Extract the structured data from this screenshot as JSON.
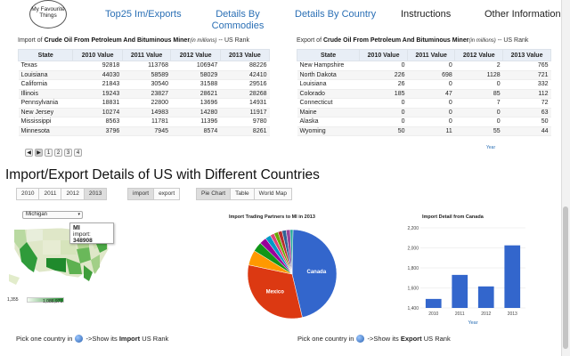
{
  "nav": {
    "logo_text": "My Favourite Things",
    "items": [
      "Top25 Im/Exports",
      "Details By Commodies",
      "Details By Country",
      "Instructions",
      "Other Information"
    ]
  },
  "import_table": {
    "title_prefix": "Import of ",
    "title_bold": "Crude Oil From Petroleum And Bituminous Miner",
    "title_italic": "(in millions)",
    "title_suffix": " -- US Rank",
    "headers": [
      "State",
      "2010 Value",
      "2011 Value",
      "2012 Value",
      "2013 Value"
    ],
    "rows": [
      [
        "Texas",
        "92818",
        "113768",
        "106947",
        "88226"
      ],
      [
        "Louisiana",
        "44030",
        "58589",
        "58029",
        "42410"
      ],
      [
        "California",
        "21843",
        "30540",
        "31588",
        "29516"
      ],
      [
        "Illinois",
        "19243",
        "23827",
        "28621",
        "28268"
      ],
      [
        "Pennsylvania",
        "18831",
        "22800",
        "13696",
        "14931"
      ],
      [
        "New Jersey",
        "10274",
        "14983",
        "14280",
        "11917"
      ],
      [
        "Mississippi",
        "8563",
        "11781",
        "11396",
        "9780"
      ],
      [
        "Minnesota",
        "3796",
        "7945",
        "8574",
        "8261"
      ]
    ]
  },
  "export_table": {
    "title_prefix": "Export of ",
    "title_bold": "Crude Oil From Petroleum And Bituminous Miner",
    "title_italic": "(in millions)",
    "title_suffix": " -- US Rank",
    "headers": [
      "State",
      "2010 Value",
      "2011 Value",
      "2012 Value",
      "2013 Value"
    ],
    "rows": [
      [
        "New Hampshire",
        "0",
        "0",
        "2",
        "765"
      ],
      [
        "North Dakota",
        "226",
        "698",
        "1128",
        "721"
      ],
      [
        "Louisiana",
        "26",
        "0",
        "0",
        "332"
      ],
      [
        "Colorado",
        "185",
        "47",
        "85",
        "112"
      ],
      [
        "Connecticut",
        "0",
        "0",
        "7",
        "72"
      ],
      [
        "Maine",
        "0",
        "0",
        "0",
        "63"
      ],
      [
        "Alaska",
        "0",
        "0",
        "0",
        "50"
      ],
      [
        "Wyoming",
        "50",
        "11",
        "55",
        "44"
      ]
    ]
  },
  "pager": [
    "◀",
    "▶",
    "1",
    "2",
    "3",
    "4"
  ],
  "year_link": "Year",
  "section_title": "Import/Export Details of US with Different Countries",
  "year_buttons": [
    "2010",
    "2011",
    "2012",
    "2013"
  ],
  "active_year": "2013",
  "direction_buttons": [
    "import",
    "export"
  ],
  "view_buttons": [
    "Pie Chart",
    "Table",
    "World Map"
  ],
  "state_select": "Michigan",
  "tooltip": {
    "state": "MI",
    "label": "import:",
    "value": "348908"
  },
  "map_legend": {
    "min": "1,355",
    "max": "1,086,971"
  },
  "pie_title": "Import Trading Partners to MI in 2013",
  "bar_title": "Import Detail from Canada",
  "bottom_left": {
    "prefix": "Pick one country in ",
    "middle": " ->Show its ",
    "bold": "Import",
    "suffix": " US Rank"
  },
  "bottom_right": {
    "prefix": "Pick one country in ",
    "middle": " ->Show its ",
    "bold": "Export",
    "suffix": " US Rank"
  },
  "colors": {
    "accent": "#2a6fb5",
    "bar": "#3366cc",
    "map_high": "#1f8a2c"
  },
  "chart_data": [
    {
      "type": "pie",
      "title": "Import Trading Partners to MI in 2013",
      "slice_labels": [
        "Canada",
        "Mexico",
        "",
        "",
        "",
        "",
        "",
        "",
        "",
        "",
        "",
        ""
      ],
      "values": [
        46,
        32,
        5.5,
        3.5,
        2.5,
        2,
        1.5,
        1.5,
        1.5,
        1.5,
        1.5,
        1
      ],
      "colors": [
        "#3366cc",
        "#dc3912",
        "#ff9900",
        "#109618",
        "#990099",
        "#0099c6",
        "#dd4477",
        "#66aa00",
        "#b82e2e",
        "#316395",
        "#994499",
        "#22aa99"
      ]
    },
    {
      "type": "bar",
      "title": "Import Detail from Canada",
      "categories": [
        "2010",
        "2011",
        "2012",
        "2013"
      ],
      "values": [
        1490,
        1730,
        1615,
        2025
      ],
      "ylim": [
        1400,
        2200
      ],
      "yticks": [
        "1,400",
        "1,600",
        "1,800",
        "2,000",
        "2,200"
      ],
      "xlabel": "Year"
    }
  ]
}
